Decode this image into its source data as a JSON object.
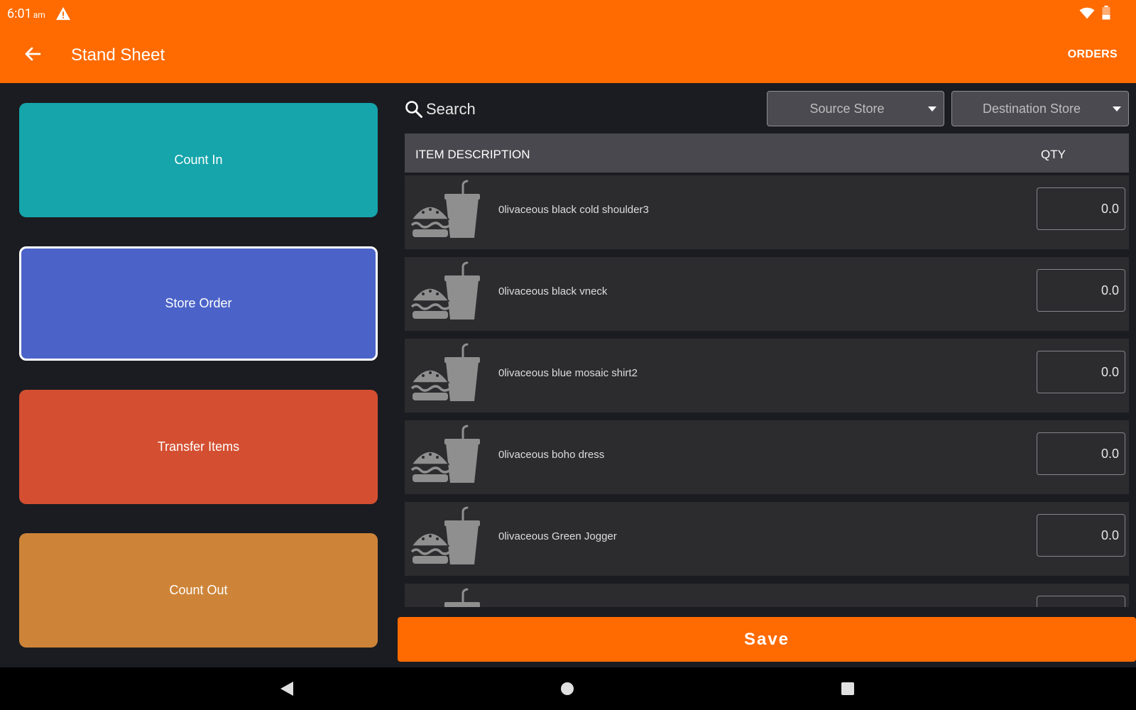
{
  "status_bar": {
    "time": "6:01",
    "ampm": "am",
    "icons": [
      "warning-icon",
      "wifi-icon",
      "battery-icon"
    ]
  },
  "app_bar": {
    "title": "Stand Sheet",
    "action": "ORDERS",
    "back_icon": "arrow-left-icon"
  },
  "actions": [
    {
      "label": "Count In",
      "color": "#15a5ab"
    },
    {
      "label": "Store Order",
      "color": "#4b63c8",
      "selected": true
    },
    {
      "label": "Transfer Items",
      "color": "#d44f31"
    },
    {
      "label": "Count Out",
      "color": "#ce8438"
    }
  ],
  "search": {
    "placeholder": "Search"
  },
  "filters": {
    "source_store": "Source Store",
    "destination_store": "Destination Store"
  },
  "table": {
    "header_description": "ITEM DESCRIPTION",
    "header_qty": "QTY",
    "rows": [
      {
        "name": "0livaceous black cold shoulder3",
        "qty": "0.0",
        "icon": "food-drink-icon"
      },
      {
        "name": "0livaceous black vneck",
        "qty": "0.0",
        "icon": "food-drink-icon"
      },
      {
        "name": "0livaceous blue mosaic shirt2",
        "qty": "0.0",
        "icon": "food-drink-icon"
      },
      {
        "name": "0livaceous boho dress",
        "qty": "0.0",
        "icon": "food-drink-icon"
      },
      {
        "name": "0livaceous Green Jogger",
        "qty": "0.0",
        "icon": "food-drink-icon"
      },
      {
        "name": "",
        "qty": "",
        "icon": "food-drink-icon"
      }
    ]
  },
  "save_label": "Save",
  "colors": {
    "accent": "#ff6b00",
    "background": "#1b1c21",
    "row": "#2c2c2f",
    "header": "#48484e"
  }
}
